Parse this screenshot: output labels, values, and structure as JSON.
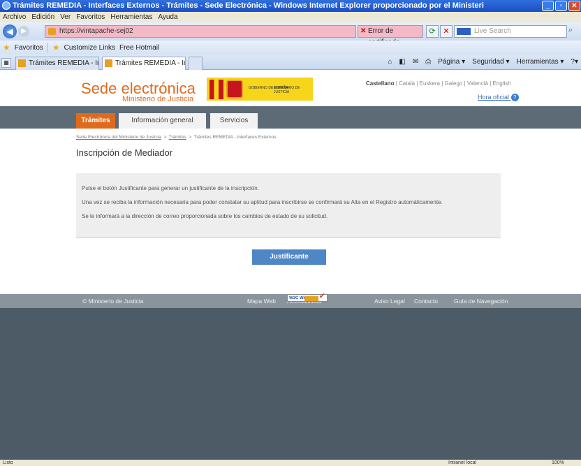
{
  "window": {
    "title": "Trámites REMEDIA - Interfaces Externos - Trámites - Sede Electrónica - Windows Internet Explorer proporcionado por el Ministeri"
  },
  "menu": [
    "Archivo",
    "Edición",
    "Ver",
    "Favoritos",
    "Herramientas",
    "Ayuda"
  ],
  "address": {
    "url": "https://vintapache-sej02",
    "cert_error": "Error de certificado",
    "search_placeholder": "Live Search"
  },
  "favorites": {
    "label": "Favoritos",
    "items": [
      "Customize Links",
      "Free Hotmail"
    ]
  },
  "tabs": [
    {
      "label": "Trámites REMEDIA - Interfac..."
    },
    {
      "label": "Trámites REMEDIA - Inter..."
    }
  ],
  "toolbar": {
    "page": "Página",
    "security": "Seguridad",
    "tools": "Herramientas"
  },
  "site": {
    "title": "Sede electrónica",
    "subtitle": "Ministerio de Justicia",
    "gov_logo": {
      "left": "GOBIERNO DE ESPAÑA",
      "right": "MINISTERIO DE JUSTICIA"
    },
    "languages": [
      "Castellano",
      "Català",
      "Euskera",
      "Galego",
      "Valencià",
      "English"
    ],
    "hora_oficial": "Hora oficial"
  },
  "nav": [
    "Trámites",
    "Información general",
    "Servicios"
  ],
  "breadcrumb": [
    "Sede Electrónica del Ministerio de Justicia",
    "Trámites",
    "Trámites REMEDIA - Interfaces Externos"
  ],
  "page_title": "Inscripción de Mediador",
  "info": [
    "Pulse el botón Justificante para generar un justificante de la inscripción.",
    "Una vez se reciba la información necesaria para poder constatar su aptitud para inscribirse se confirmará su Alta en el Registro automáticamente.",
    "Se le informará a la dirección de correo proporcionada sobre los cambios de estado de su solicitud."
  ],
  "button": "Justificante",
  "footer": {
    "copyright": "© Ministerio de Justicia",
    "mapa": "Mapa Web",
    "accesibilidad": "Accesibilidad",
    "w3c": "W3C WAI-AA",
    "aviso": "Aviso Legal",
    "contacto": "Contacto",
    "guia": "Guía de Navegación"
  },
  "status": {
    "left": "Listo",
    "zone": "Intranet local",
    "zoom": "100%"
  }
}
